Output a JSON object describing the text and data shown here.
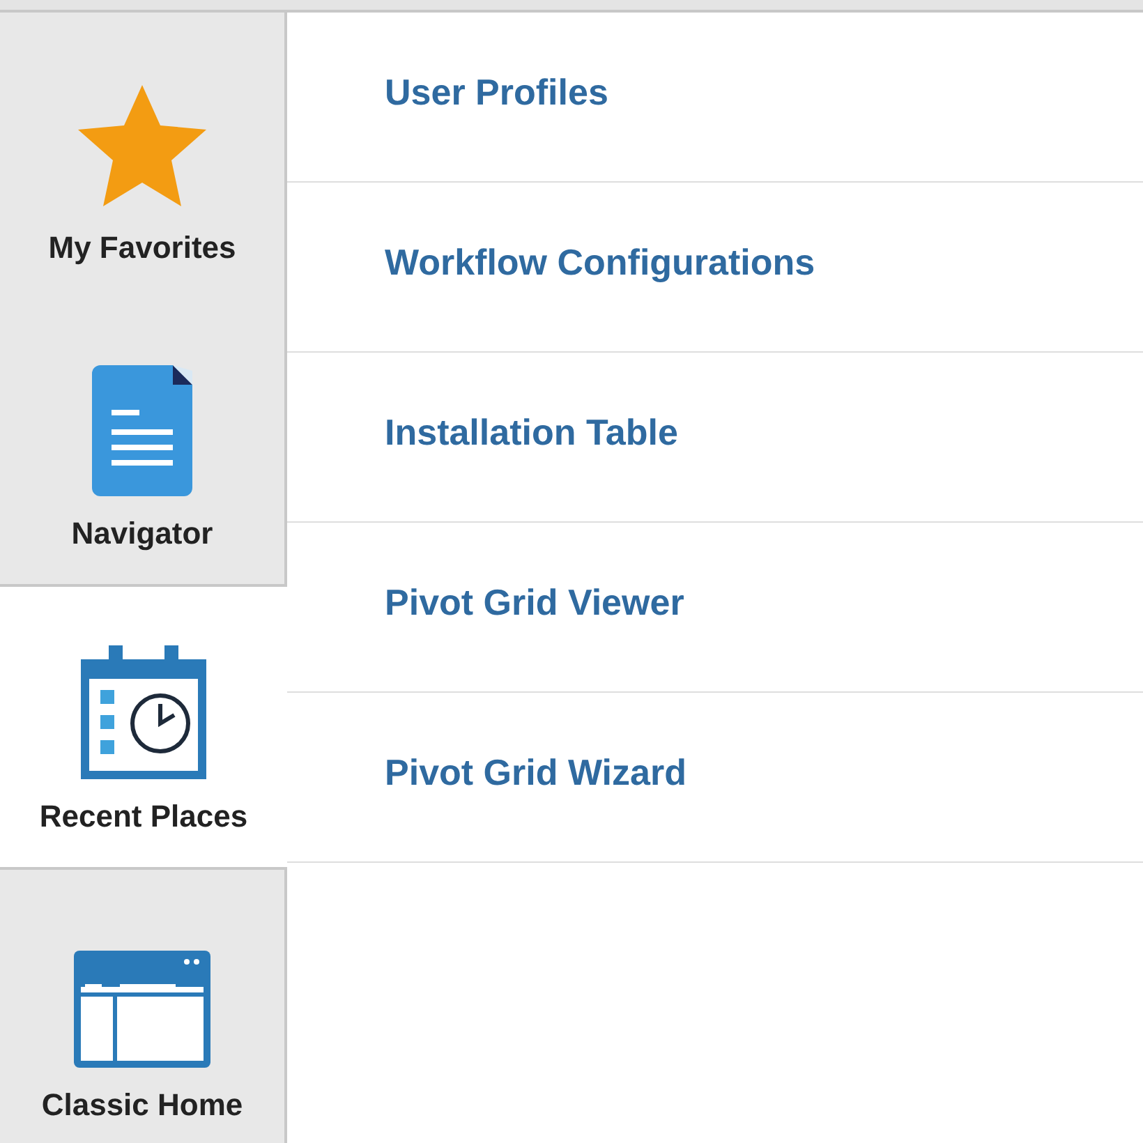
{
  "tabs": [
    {
      "kind": "star",
      "label": "My Favorites",
      "selected": false
    },
    {
      "kind": "document",
      "label": "Navigator",
      "selected": false
    },
    {
      "kind": "calendar",
      "label": "Recent Places",
      "selected": true
    },
    {
      "kind": "window",
      "label": "Classic Home",
      "selected": false
    }
  ],
  "links": [
    "User Profiles",
    "Workflow Configurations",
    "Installation Table",
    "Pivot Grid Viewer",
    "Pivot Grid Wizard"
  ]
}
